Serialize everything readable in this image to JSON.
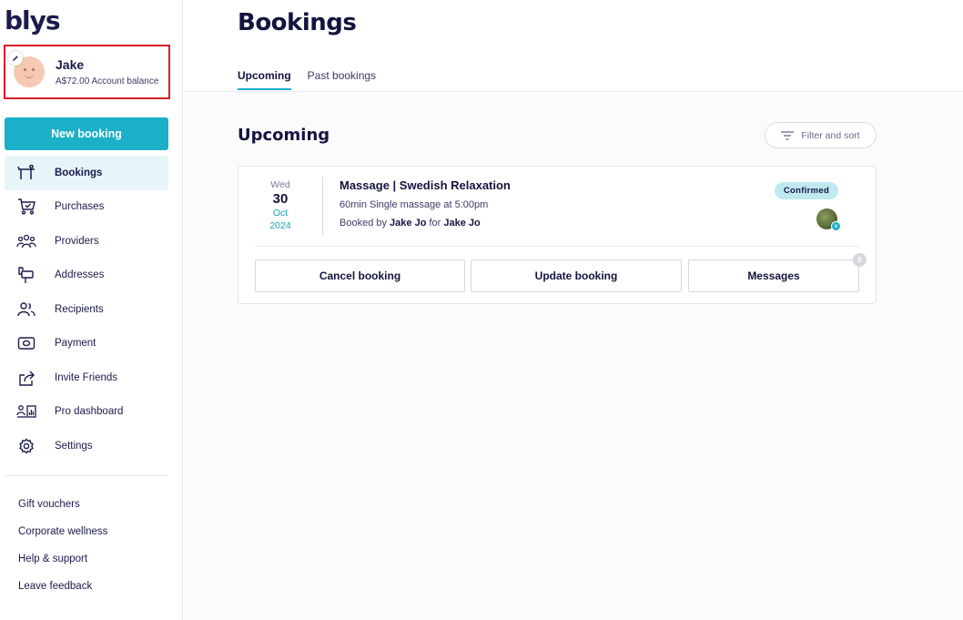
{
  "brand": {
    "logo_text": "blys",
    "accent": "#1ab0c8",
    "highlight_border": "#d81e27"
  },
  "profile": {
    "name": "Jake",
    "balance": "A$72.00 Account balance",
    "edit_icon": "pencil-icon"
  },
  "sidebar": {
    "new_booking_label": "New booking",
    "items": [
      {
        "label": "Bookings",
        "icon": "massage-table-icon",
        "active": true
      },
      {
        "label": "Purchases",
        "icon": "cart-icon",
        "active": false
      },
      {
        "label": "Providers",
        "icon": "group-icon",
        "active": false
      },
      {
        "label": "Addresses",
        "icon": "mailbox-icon",
        "active": false
      },
      {
        "label": "Recipients",
        "icon": "users-icon",
        "active": false
      },
      {
        "label": "Payment",
        "icon": "cash-icon",
        "active": false
      },
      {
        "label": "Invite Friends",
        "icon": "share-icon",
        "active": false
      },
      {
        "label": "Pro dashboard",
        "icon": "pro-dashboard-icon",
        "active": false
      },
      {
        "label": "Settings",
        "icon": "gear-icon",
        "active": false
      }
    ],
    "footer_links": [
      "Gift vouchers",
      "Corporate wellness",
      "Help & support",
      "Leave feedback"
    ]
  },
  "main": {
    "title": "Bookings",
    "tabs": [
      {
        "label": "Upcoming",
        "active": true
      },
      {
        "label": "Past bookings",
        "active": false
      }
    ],
    "section_title": "Upcoming",
    "filter_label": "Filter and sort"
  },
  "booking": {
    "date": {
      "dow": "Wed",
      "day": "30",
      "month": "Oct",
      "year": "2024"
    },
    "title": "Massage | Swedish Relaxation",
    "detail": "60min Single massage at 5:00pm",
    "booked_by_prefix": "Booked by",
    "booked_by": "Jake Jo",
    "for_word": "for",
    "booked_for": "Jake Jo",
    "status": "Confirmed",
    "verified_mark": "v",
    "actions": {
      "cancel": "Cancel booking",
      "update": "Update booking",
      "messages": "Messages",
      "message_count": "0"
    }
  }
}
